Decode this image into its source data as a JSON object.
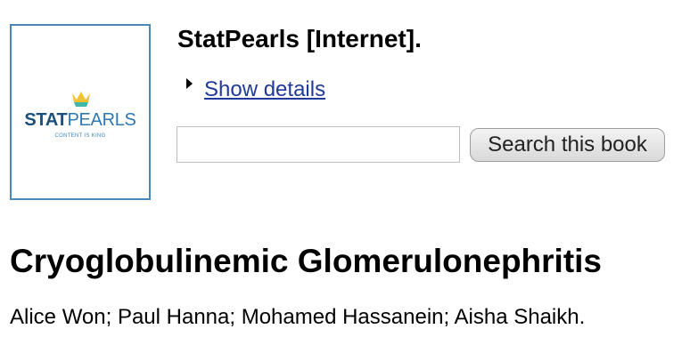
{
  "book": {
    "title": "StatPearls [Internet].",
    "details_link": "Show details",
    "cover": {
      "brand_bold": "STAT",
      "brand_light": "PEARLS",
      "tagline": "CONTENT IS KING",
      "border_color": "#4b87b9",
      "brand_dark_color": "#1b4f7c",
      "brand_light_color": "#2e78b4",
      "crown_colors": [
        "#f2c230",
        "#3fb6a8"
      ]
    }
  },
  "search": {
    "value": "",
    "placeholder": "",
    "button_label": "Search this book"
  },
  "article": {
    "title": "Cryoglobulinemic Glomerulonephritis",
    "authors": "Alice Won; Paul Hanna; Mohamed Hassanein; Aisha Shaikh."
  },
  "icons": {
    "details_toggle": "triangle-right-icon",
    "cover_logo": "crown-icon"
  },
  "colors": {
    "link": "#1f3a9b",
    "text": "#000000"
  }
}
